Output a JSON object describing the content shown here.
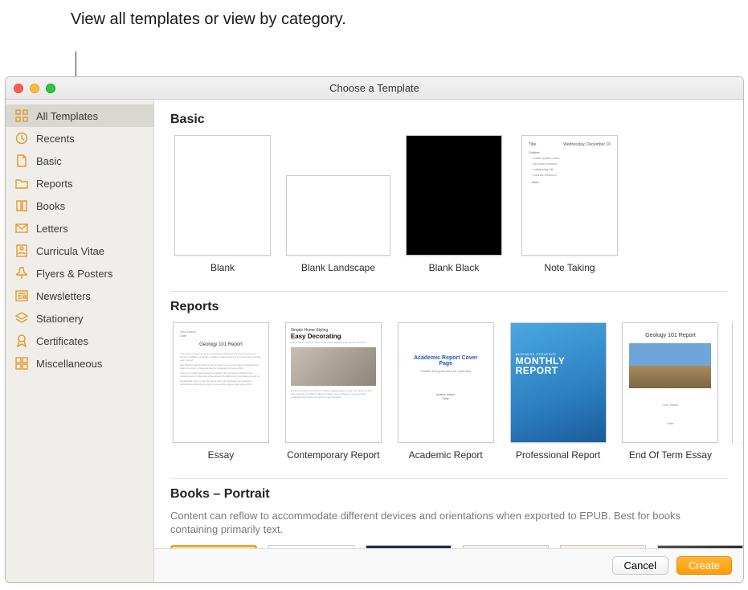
{
  "callout": "View all templates or view by category.",
  "window_title": "Choose a Template",
  "sidebar": {
    "items": [
      {
        "label": "All Templates",
        "icon": "grid-icon",
        "selected": true
      },
      {
        "label": "Recents",
        "icon": "clock-icon"
      },
      {
        "label": "Basic",
        "icon": "document-icon"
      },
      {
        "label": "Reports",
        "icon": "folder-icon"
      },
      {
        "label": "Books",
        "icon": "book-icon"
      },
      {
        "label": "Letters",
        "icon": "envelope-icon"
      },
      {
        "label": "Curricula Vitae",
        "icon": "profile-icon"
      },
      {
        "label": "Flyers & Posters",
        "icon": "pin-icon"
      },
      {
        "label": "Newsletters",
        "icon": "news-icon"
      },
      {
        "label": "Stationery",
        "icon": "layers-icon"
      },
      {
        "label": "Certificates",
        "icon": "ribbon-icon"
      },
      {
        "label": "Miscellaneous",
        "icon": "misc-icon"
      }
    ]
  },
  "sections": {
    "basic": {
      "title": "Basic",
      "templates": [
        {
          "label": "Blank"
        },
        {
          "label": "Blank Landscape"
        },
        {
          "label": "Blank Black"
        },
        {
          "label": "Note Taking"
        }
      ]
    },
    "reports": {
      "title": "Reports",
      "templates": [
        {
          "label": "Essay"
        },
        {
          "label": "Contemporary Report"
        },
        {
          "label": "Academic Report"
        },
        {
          "label": "Professional Report"
        },
        {
          "label": "End Of Term Essay"
        }
      ]
    },
    "books": {
      "title": "Books – Portrait",
      "description": "Content can reflow to accommodate different devices and orientations when exported to EPUB. Best for books containing primarily text."
    }
  },
  "thumbs": {
    "essay_title": "Geology 101 Report",
    "contemp_sub": "Simple Home Styling",
    "contemp_title": "Easy Decorating",
    "acad_title": "Academic Report Cover Page",
    "prof_small": "BUSINESS STRATEGY",
    "prof_big1": "MONTHLY",
    "prof_big2": "REPORT",
    "eot_title": "Geology 101 Report"
  },
  "footer": {
    "cancel": "Cancel",
    "create": "Create"
  }
}
